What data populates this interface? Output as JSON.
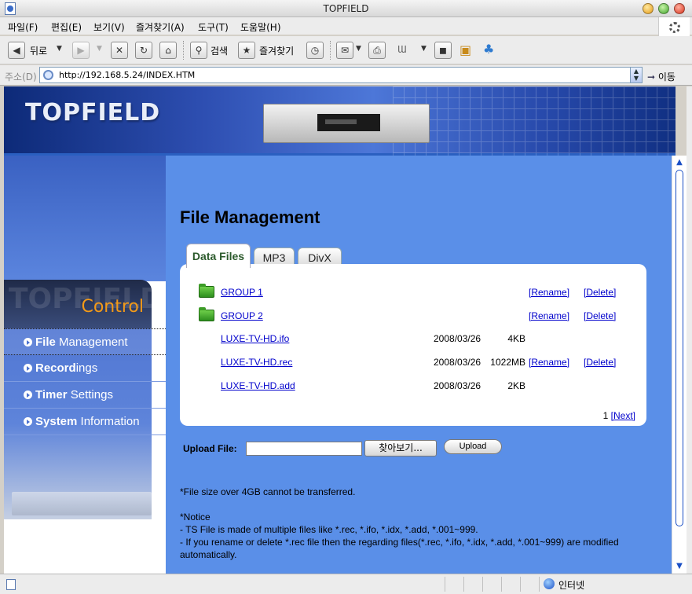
{
  "window": {
    "title": "TOPFIELD"
  },
  "menubar": [
    "파일(F)",
    "편집(E)",
    "보기(V)",
    "즐겨찾기(A)",
    "도구(T)",
    "도움말(H)"
  ],
  "toolbar": {
    "back_label": "뒤로",
    "search_label": "검색",
    "favorites_label": "즐겨찾기"
  },
  "address": {
    "label": "주소(D)",
    "url": "http://192.168.5.24/INDEX.HTM",
    "go_label": "이동"
  },
  "banner": {
    "logo": "TOPFIELD"
  },
  "sidebar": {
    "ghost": "TOPFIELD",
    "heading": "Control",
    "items": [
      {
        "bold": "File",
        "rest": " Management"
      },
      {
        "bold": "Record",
        "rest": "ings"
      },
      {
        "bold": "Timer",
        "rest": " Settings"
      },
      {
        "bold": "System",
        "rest": " Information"
      }
    ]
  },
  "main": {
    "title": "File Management",
    "tabs": [
      "Data Files",
      "MP3",
      "DivX"
    ],
    "rows": [
      {
        "name": "GROUP 1",
        "date": "",
        "size": "",
        "rename": "[Rename]",
        "delete": "[Delete]"
      },
      {
        "name": "GROUP 2",
        "date": "",
        "size": "",
        "rename": "[Rename]",
        "delete": "[Delete]"
      },
      {
        "name": "LUXE-TV-HD.ifo",
        "date": "2008/03/26",
        "size": "4KB",
        "rename": "",
        "delete": ""
      },
      {
        "name": "LUXE-TV-HD.rec",
        "date": "2008/03/26",
        "size": "1022MB",
        "rename": "[Rename]",
        "delete": "[Delete]"
      },
      {
        "name": "LUXE-TV-HD.add",
        "date": "2008/03/26",
        "size": "2KB",
        "rename": "",
        "delete": ""
      }
    ],
    "pager": {
      "page": "1",
      "next": "[Next]"
    },
    "upload": {
      "label": "Upload File:",
      "value": "",
      "browse": "찾아보기...",
      "button": "Upload"
    },
    "notes": {
      "size_limit": "*File size over 4GB cannot be transferred.",
      "notice_title": "*Notice",
      "line1": "- TS File is made of multiple files like *.rec, *.ifo, *.idx, *.add, *.001~999.",
      "line2": "- If you rename or delete *.rec file then the regarding files(*.rec, *.ifo, *.idx, *.add, *.001~999) are modified automatically."
    }
  },
  "statusbar": {
    "zone": "인터넷"
  }
}
